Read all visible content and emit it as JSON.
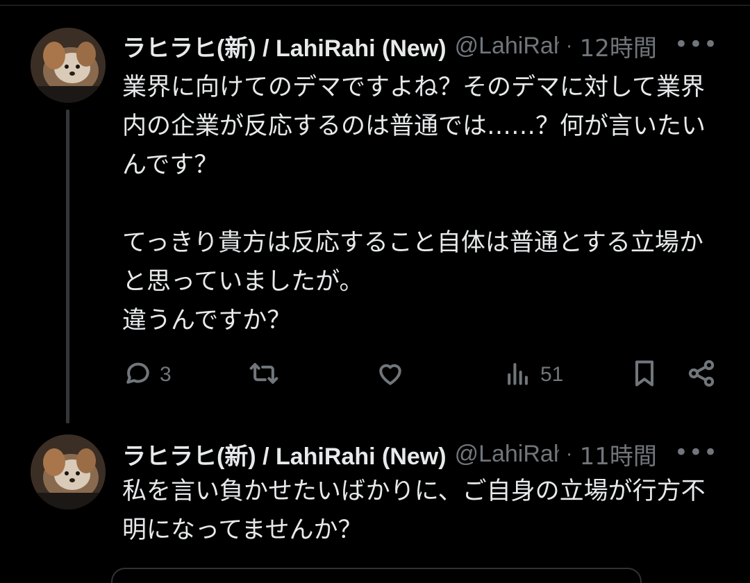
{
  "tweets": [
    {
      "display_name": "ラヒラヒ(新) / LahiRahi (New)",
      "handle": "@LahiRahi",
      "separator": "·",
      "time": "12時間",
      "more": "•••",
      "text": "業界に向けてのデマですよね？そのデマに対して業界内の企業が反応するのは普通では……？何が言いたいんです？\n\nてっきり貴方は反応すること自体は普通とする立場かと思っていましたが。\n違うんですか？",
      "actions": {
        "reply_count": "3",
        "retweet_count": "",
        "like_count": "",
        "views_count": "51"
      }
    },
    {
      "display_name": "ラヒラヒ(新) / LahiRahi (New)",
      "handle": "@LahiRahi",
      "separator": "·",
      "time": "11時間",
      "more": "•••",
      "text": "私を言い負かせたいばかりに、ご自身の立場が行方不明になってませんか？"
    }
  ],
  "theme": {
    "background": "#000000",
    "text": "#e7e9ea",
    "muted": "#71767b",
    "line": "#333639"
  },
  "icons": [
    "reply-icon",
    "retweet-icon",
    "like-icon",
    "views-icon",
    "bookmark-icon",
    "share-icon",
    "more-icon"
  ]
}
